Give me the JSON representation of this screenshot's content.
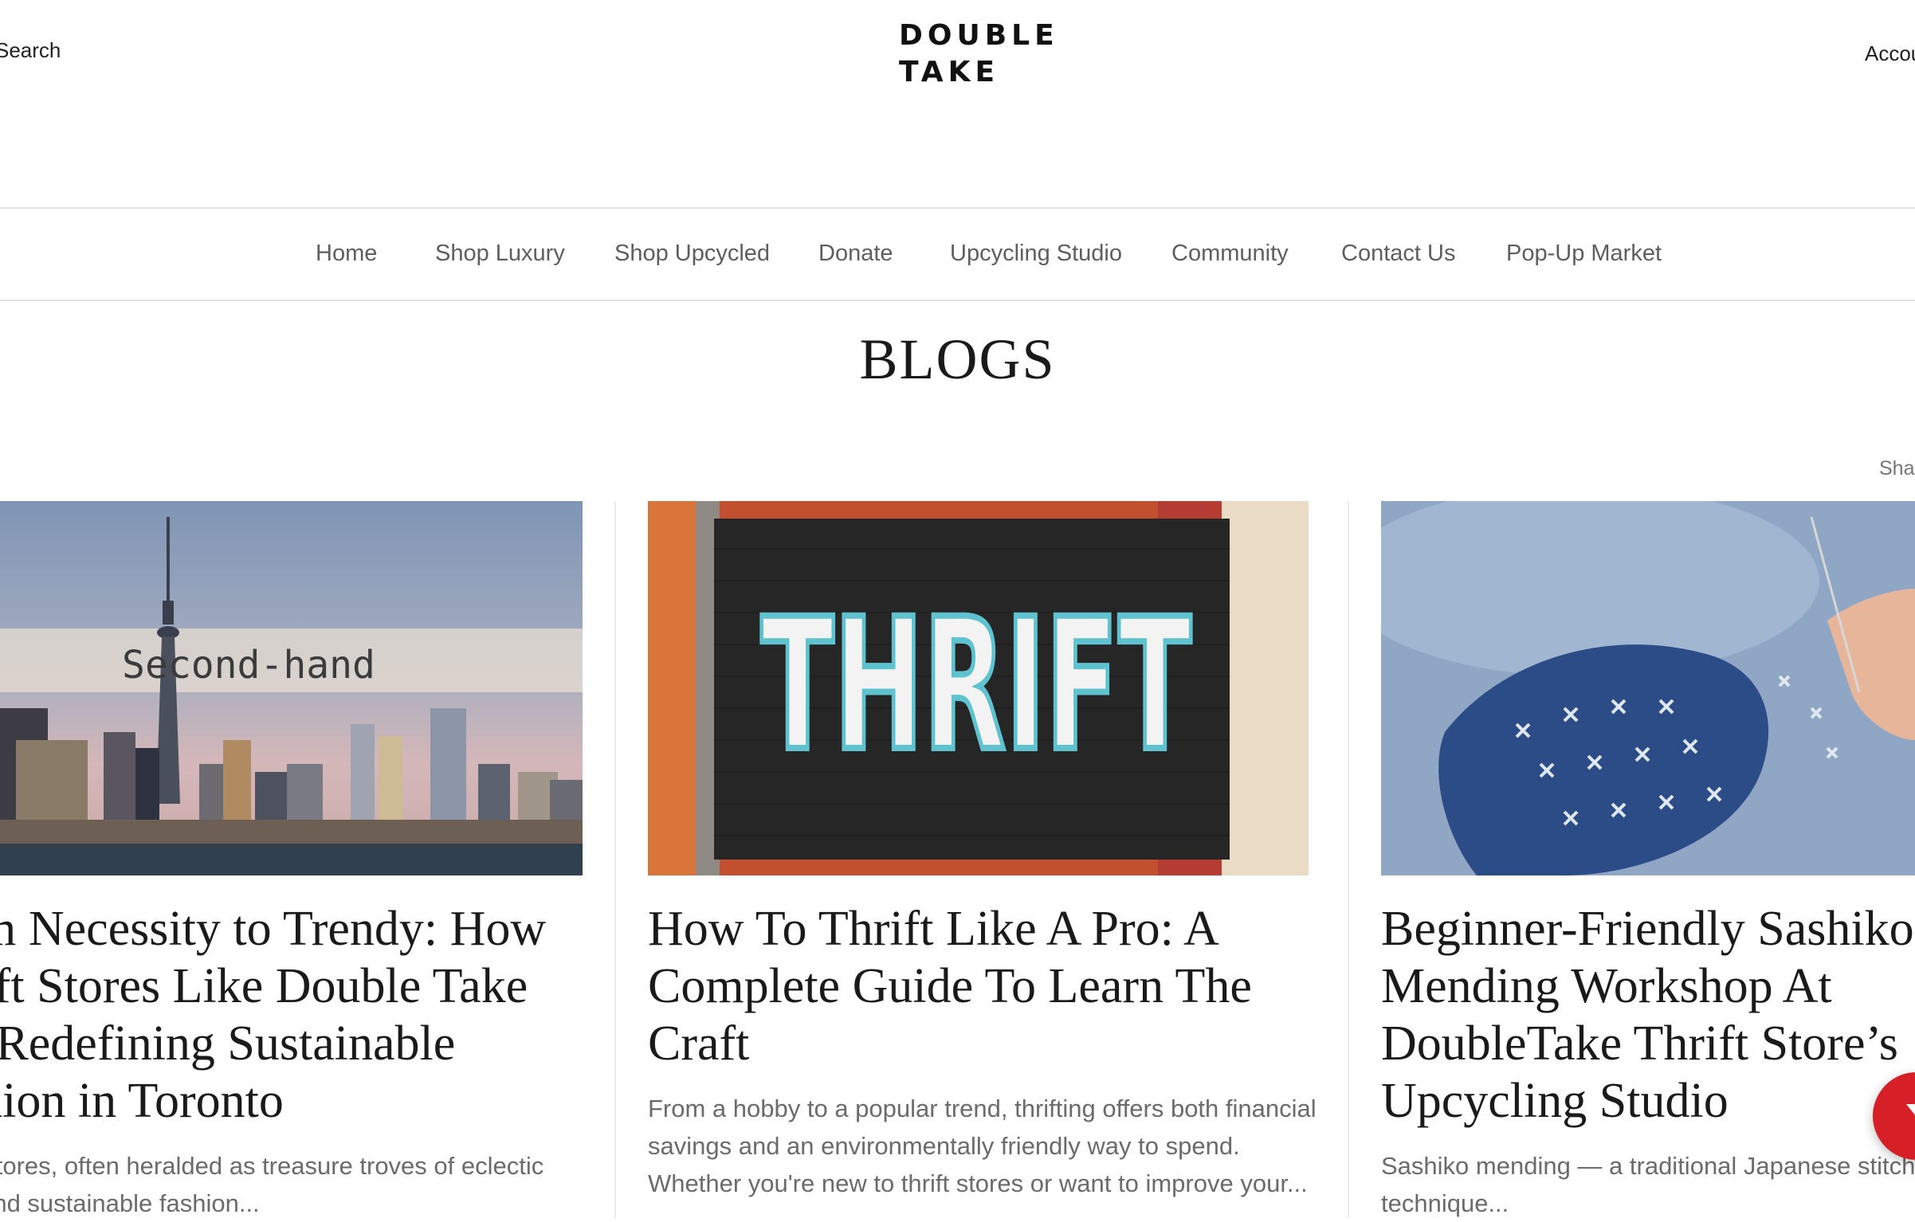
{
  "header": {
    "search_label": "Search",
    "logo_line1": "DOUBLE",
    "logo_line2": "TAKE",
    "account_label": "Account"
  },
  "nav": {
    "items": [
      {
        "label": "Home"
      },
      {
        "label": "Shop Luxury"
      },
      {
        "label": "Shop Upcycled"
      },
      {
        "label": "Donate"
      },
      {
        "label": "Upcycling Studio"
      },
      {
        "label": "Community"
      },
      {
        "label": "Contact Us"
      },
      {
        "label": "Pop-Up Market"
      }
    ]
  },
  "page": {
    "title": "BLOGS",
    "share_label": "Share"
  },
  "posts": [
    {
      "image_text": "Second-hand",
      "title": "From Necessity to Trendy: How Thrift Stores Like Double Take Are Redefining Sustainable Fashion in Toronto",
      "excerpt": "Thrift stores, often heralded as treasure troves of eclectic finds and sustainable fashion..."
    },
    {
      "image_text": "THRIFT",
      "title": "How To Thrift Like A Pro: A Complete Guide To Learn The Craft",
      "excerpt": "From a hobby to a popular trend, thrifting offers both financial savings and an environmentally friendly way to spend. Whether you're new to thrift stores or want to improve your..."
    },
    {
      "image_text": "",
      "title": "Beginner-Friendly Sashiko Mending Workshop At DoubleTake Thrift Store’s Upcycling Studio",
      "excerpt": "Sashiko mending — a traditional Japanese stitching technique..."
    }
  ],
  "colors": {
    "accent_red": "#d61f26",
    "nav_text": "#5e5e5e",
    "thrift_cyan": "#5fc3cf"
  }
}
